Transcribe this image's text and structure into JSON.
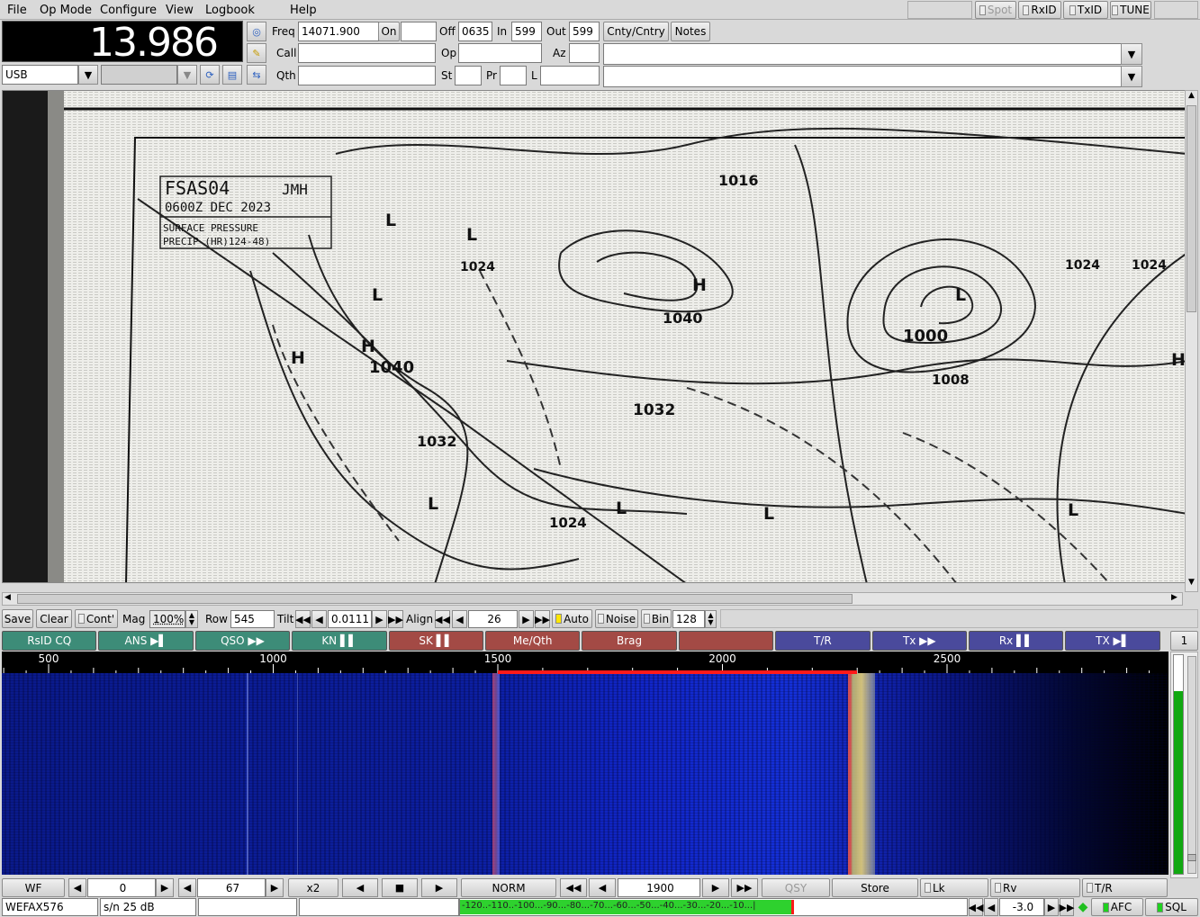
{
  "menu": {
    "file": "File",
    "opmode": "Op Mode",
    "configure": "Configure",
    "view": "View",
    "logbook": "Logbook",
    "help": "Help",
    "spot": "Spot",
    "rxid": "RxID",
    "txid": "TxID",
    "tune": "TUNE"
  },
  "freq_display": "13.986",
  "mode": {
    "value": "USB",
    "secondary": ""
  },
  "log": {
    "freq_label": "Freq",
    "freq_value": "14071.900",
    "on_label": "On",
    "on_value": "",
    "off_label": "Off",
    "off_value": "0635",
    "in_label": "In",
    "in_value": "599",
    "out_label": "Out",
    "out_value": "599",
    "cnty_button": "Cnty/Cntry",
    "notes_button": "Notes",
    "call_label": "Call",
    "call_value": "",
    "op_label": "Op",
    "op_value": "",
    "az_label": "Az",
    "az_value": "",
    "qth_label": "Qth",
    "qth_value": "",
    "st_label": "St",
    "st_value": "",
    "pr_label": "Pr",
    "pr_value": "",
    "l_label": "L",
    "l_value": "",
    "notes_line1": "",
    "notes_line2": ""
  },
  "wefax_image": {
    "chart_id": "FSAS04",
    "station": "JMH",
    "datetime": "0600Z DEC 2023",
    "caption1": "SURFACE PRESSURE",
    "caption2": "PRECIP (HR)124-48)",
    "isobars": [
      "1016",
      "1024",
      "1024",
      "1024",
      "1040",
      "1040",
      "1032",
      "1032",
      "1024",
      "1000",
      "1008"
    ],
    "highs": [
      "H",
      "H",
      "H",
      "H"
    ],
    "lows": [
      "L",
      "L",
      "L",
      "L",
      "L",
      "L",
      "L",
      "L"
    ]
  },
  "wefax_controls": {
    "save": "Save",
    "clear": "Clear",
    "cont": "Cont'",
    "mag_label": "Mag",
    "mag_value": "100%",
    "row_label": "Row",
    "row_value": "545",
    "tilt_label": "Tilt",
    "tilt_value": "0.0111",
    "align_label": "Align",
    "align_value": "26",
    "auto": "Auto",
    "noise": "Noise",
    "bin": "Bin",
    "bin_value": "128"
  },
  "macros": [
    {
      "label": "RsID CQ",
      "color": "#3d8c78"
    },
    {
      "label": "ANS ▶▌",
      "color": "#3d8c78"
    },
    {
      "label": "QSO ▶▶",
      "color": "#3d8c78"
    },
    {
      "label": "KN ▌▌",
      "color": "#3d8c78"
    },
    {
      "label": "SK ▌▌",
      "color": "#a34a45"
    },
    {
      "label": "Me/Qth",
      "color": "#a34a45"
    },
    {
      "label": "Brag",
      "color": "#a34a45"
    },
    {
      "label": "",
      "color": "#a34a45"
    },
    {
      "label": "T/R",
      "color": "#4a4a9c"
    },
    {
      "label": "Tx ▶▶",
      "color": "#4a4a9c"
    },
    {
      "label": "Rx ▌▌",
      "color": "#4a4a9c"
    },
    {
      "label": "TX ▶▌",
      "color": "#4a4a9c"
    }
  ],
  "macro_set": "1",
  "waterfall": {
    "scale_labels": [
      "500",
      "1000",
      "1500",
      "2000",
      "2500"
    ],
    "scale_values": [
      500,
      1000,
      1500,
      2000,
      2500
    ],
    "passband_start_hz": 1500,
    "passband_end_hz": 2300
  },
  "wf_controls": {
    "wf": "WF",
    "offset": "0",
    "level": "67",
    "zoom": "x2",
    "norm": "NORM",
    "freq": "1900",
    "qsy": "QSY",
    "store": "Store",
    "lk": "Lk",
    "rv": "Rv",
    "tr": "T/R"
  },
  "status": {
    "mode": "WEFAX576",
    "sn": "s/n  25 dB",
    "msg": "",
    "meter": "-120..-110..-100...-90...-80...-70...-60...-50...-40...-30...-20...-10...|",
    "afc_value": "-3.0",
    "afc": "AFC",
    "sql": "SQL"
  }
}
